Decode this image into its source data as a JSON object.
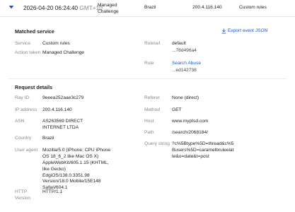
{
  "event": {
    "timestamp": "2026-04-20 06:24:40",
    "timezone": "GMT+10",
    "action": "Managed Challenge",
    "country": "Brazil",
    "ip": "200.4.116.140",
    "service": "Custom rules"
  },
  "matched_service": {
    "heading": "Matched service",
    "export_label": "Export event JSON",
    "service_label": "Service",
    "service_value": "Custom rules",
    "action_label": "Action taken",
    "action_value": "Managed Challenge",
    "ruleset_label": "Ruleset",
    "ruleset_value": "default",
    "ruleset_id": "...78d496a4",
    "rule_label": "Rule",
    "rule_value": "Search Abuse",
    "rule_id": "...ed142738"
  },
  "request_details": {
    "heading": "Request details",
    "ray_id_label": "Ray ID",
    "ray_id_value": "9eeea252aae3c279",
    "ip_label": "IP address",
    "ip_value": "200.4.116.140",
    "asn_label": "ASN",
    "asn_value": "AS263569 DIRECT INTERNET LTDA",
    "country_label": "Country",
    "country_value": "Brazil",
    "ua_label": "User agent",
    "ua_value": "Mozilla/5.0 (iPhone; CPU iPhone OS 18_6_2 like Mac OS X) AppleWebKit/605.1.15 (KHTML, like Gecko) EdgiOS/138.0.3351.98 Version/18.0 Mobile/15E148 Safari/604.1",
    "http_label": "HTTP Version",
    "http_value": "HTTP/1.1",
    "referer_label": "Referer",
    "referer_value": "None (direct)",
    "method_label": "Method",
    "method_value": "GET",
    "host_label": "Host",
    "host_value": "www.myptsd.com",
    "path_label": "Path",
    "path_value": "/search/2068184/",
    "query_label": "Query string",
    "query_value": "?c%5Btype%5D=thread&c%5Busers%5D=caramelbruleelatte&o=date&t=post"
  }
}
